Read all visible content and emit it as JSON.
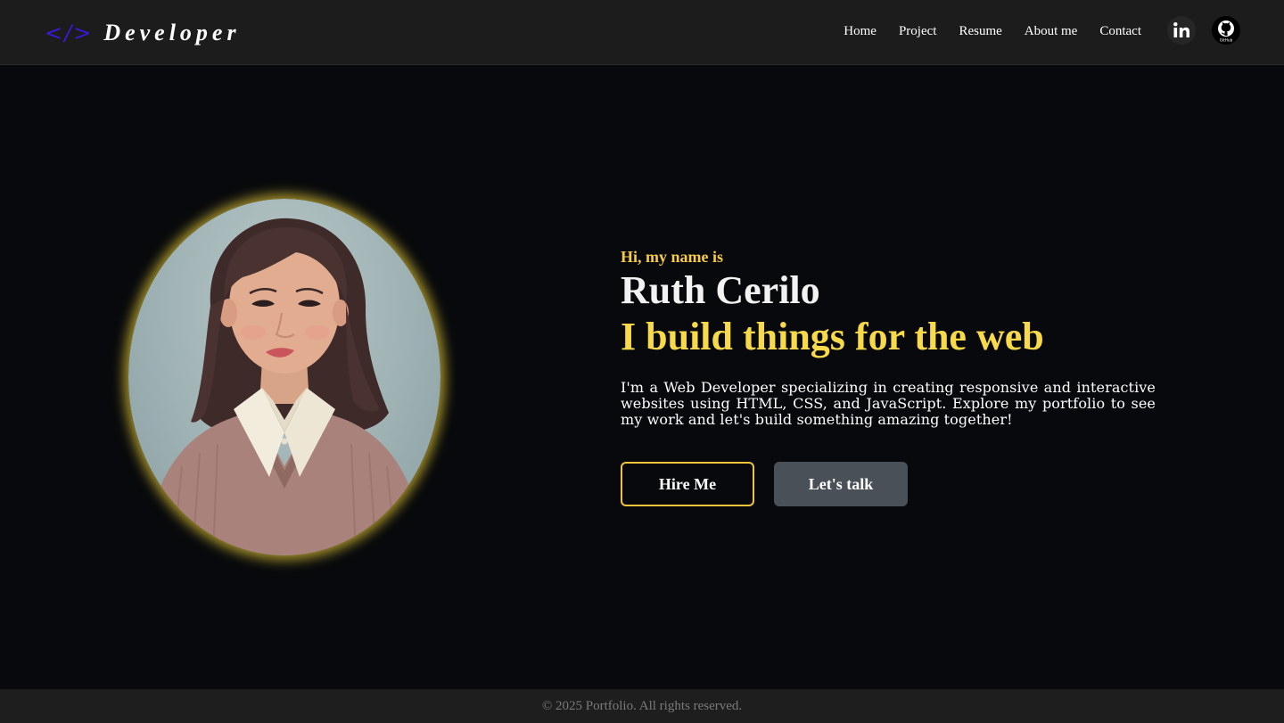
{
  "logo": {
    "symbol": "</>",
    "text": "Developer"
  },
  "nav": {
    "home": "Home",
    "project": "Project",
    "resume": "Resume",
    "about": "About me",
    "contact": "Contact"
  },
  "social": {
    "linkedin_icon": "linkedin-icon",
    "github_icon": "github-icon",
    "github_text": "GitHub"
  },
  "hero": {
    "greeting": "Hi, my name is",
    "name": "Ruth Cerilo",
    "tagline": "I build things for the web",
    "description": "I'm a Web Developer specializing in creating responsive and interactive websites using HTML, CSS, and JavaScript. Explore my portfolio to see my work and let's build something amazing together!",
    "hire_label": "Hire Me",
    "talk_label": "Let's talk"
  },
  "footer": {
    "copyright": "© 2025 Portfolio. All rights reserved."
  },
  "colors": {
    "accent_yellow": "#f7d94a",
    "logo_purple": "#3d17d6",
    "background": "#07090c",
    "navbar": "#1c1c1c",
    "secondary_button": "#4a5058"
  }
}
